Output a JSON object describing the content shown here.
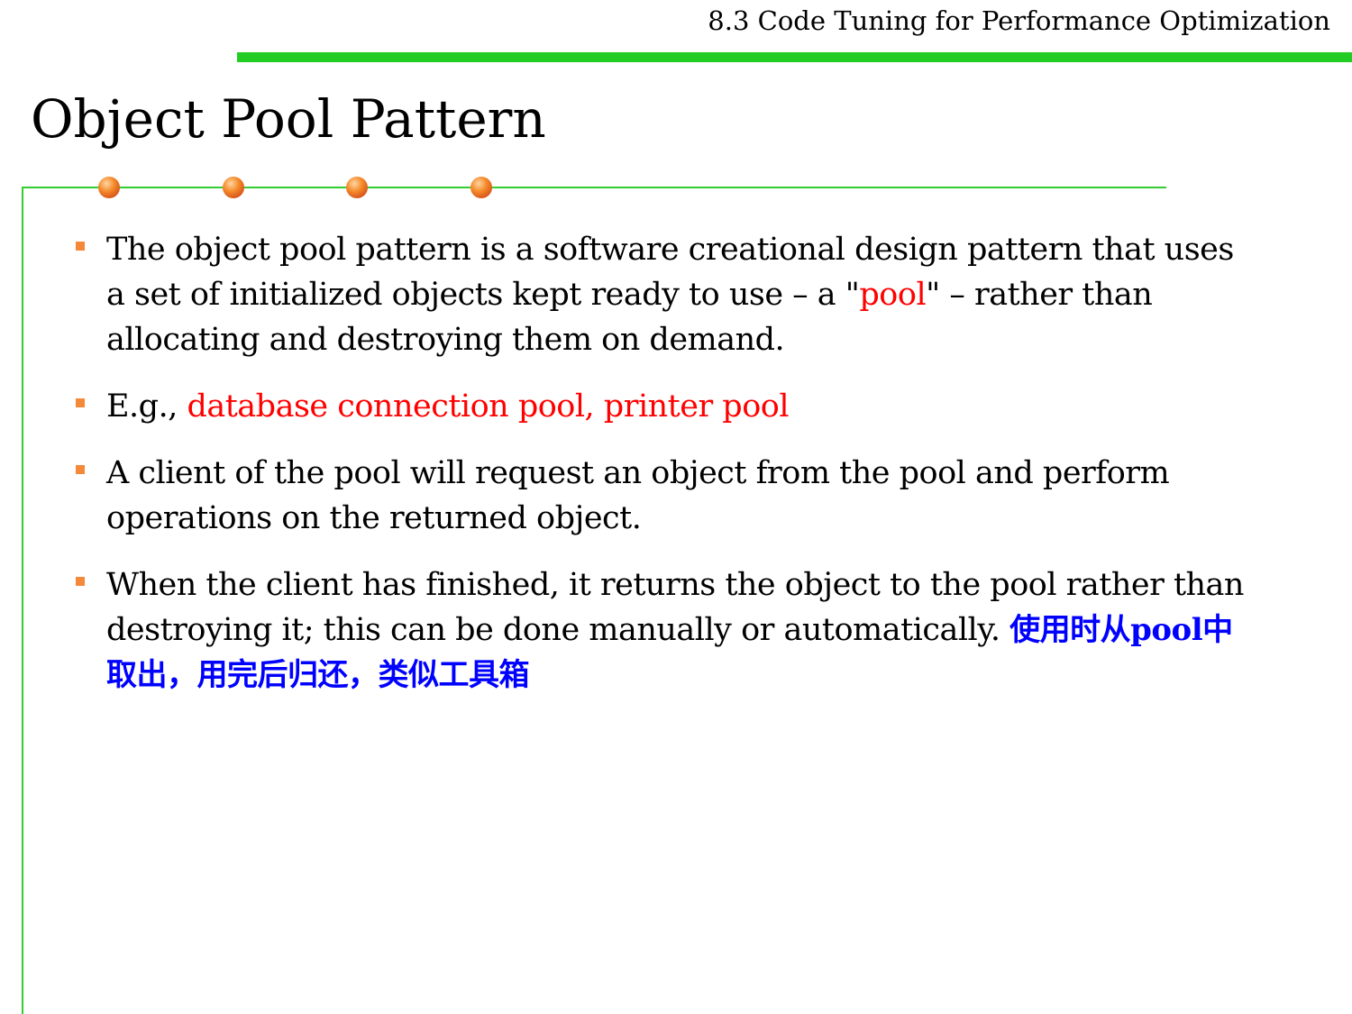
{
  "header": {
    "section_title": "8.3 Code Tuning for Performance Optimization"
  },
  "page": {
    "title": "Object Pool Pattern"
  },
  "colors": {
    "accent_bar": "#22cc22",
    "frame_line": "#33cc33",
    "bullet_marker": "#f5893a",
    "highlight_red": "#ff0000",
    "highlight_blue": "#0000ff"
  },
  "bullets": [
    {
      "text_1": "The object pool pattern is a software creational design pattern that uses a set of initialized objects kept ready to use – a \"",
      "highlight": "pool",
      "text_2": "\" – rather than allocating and destroying them on demand."
    },
    {
      "text_1": "E.g., ",
      "highlight": "database connection pool, printer pool"
    },
    {
      "text_1": "A client of the pool will request an object from the pool and perform operations on the returned object."
    },
    {
      "text_1": "When the client has finished, it returns the object to the pool rather than destroying it; this can be done manually or automatically. ",
      "note_cn_1": "使用时从",
      "note_latin": "pool",
      "note_cn_2": "中取出，用完后归还，类似工具箱"
    }
  ]
}
